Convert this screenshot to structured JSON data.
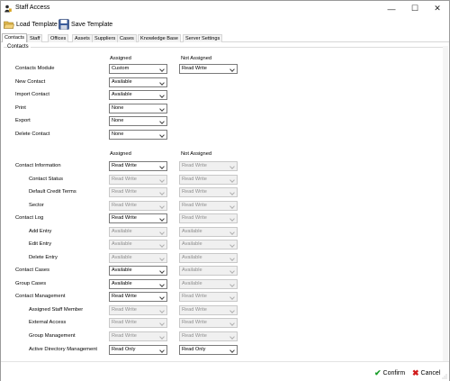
{
  "window": {
    "title": "Staff Access",
    "min_glyph": "—",
    "max_glyph": "☐",
    "close_glyph": "✕"
  },
  "toolbar": {
    "load_label": "Load Template",
    "save_label": "Save Template"
  },
  "tabs": [
    "Contacts",
    "Staff",
    "Offices",
    "Assets",
    "Suppliers",
    "Cases",
    "Knowledge Base",
    "Server Settings"
  ],
  "active_tab": "Contacts",
  "section": {
    "title": "Contacts"
  },
  "headers": {
    "assigned": "Assigned",
    "not_assigned": "Not Assigned"
  },
  "module": {
    "label": "Contacts Module",
    "assigned": "Custom",
    "not_assigned": "Read Write"
  },
  "basic_rows": [
    {
      "label": "New Contact",
      "assigned": "Available"
    },
    {
      "label": "Import Contact",
      "assigned": "Available"
    },
    {
      "label": "Print",
      "assigned": "None"
    },
    {
      "label": "Export",
      "assigned": "None"
    },
    {
      "label": "Delete Contact",
      "assigned": "None"
    }
  ],
  "detail_rows": [
    {
      "label": "Contact Information",
      "indent": false,
      "assigned": "Read Write",
      "not_assigned": "Read Write",
      "assigned_enabled": true,
      "not_enabled": false
    },
    {
      "label": "Contact Status",
      "indent": true,
      "assigned": "Read Write",
      "not_assigned": "Read Write",
      "assigned_enabled": false,
      "not_enabled": false
    },
    {
      "label": "Default Credit Terms",
      "indent": true,
      "assigned": "Read Write",
      "not_assigned": "Read Write",
      "assigned_enabled": false,
      "not_enabled": false
    },
    {
      "label": "Sector",
      "indent": true,
      "assigned": "Read Write",
      "not_assigned": "Read Write",
      "assigned_enabled": false,
      "not_enabled": false
    },
    {
      "label": "Contact Log",
      "indent": false,
      "assigned": "Read Write",
      "not_assigned": "Read Write",
      "assigned_enabled": true,
      "not_enabled": false
    },
    {
      "label": "Add Entry",
      "indent": true,
      "assigned": "Available",
      "not_assigned": "Available",
      "assigned_enabled": false,
      "not_enabled": false
    },
    {
      "label": "Edit Entry",
      "indent": true,
      "assigned": "Available",
      "not_assigned": "Available",
      "assigned_enabled": false,
      "not_enabled": false
    },
    {
      "label": "Delete Entry",
      "indent": true,
      "assigned": "Available",
      "not_assigned": "Available",
      "assigned_enabled": false,
      "not_enabled": false
    },
    {
      "label": "Contact Cases",
      "indent": false,
      "assigned": "Available",
      "not_assigned": "Available",
      "assigned_enabled": true,
      "not_enabled": false
    },
    {
      "label": "Group Cases",
      "indent": false,
      "assigned": "Available",
      "not_assigned": "Available",
      "assigned_enabled": true,
      "not_enabled": false
    },
    {
      "label": "Contact Management",
      "indent": false,
      "assigned": "Read Write",
      "not_assigned": "Read Write",
      "assigned_enabled": true,
      "not_enabled": false
    },
    {
      "label": "Assigned Staff Member",
      "indent": true,
      "assigned": "Read Write",
      "not_assigned": "Read Write",
      "assigned_enabled": false,
      "not_enabled": false
    },
    {
      "label": "External Access",
      "indent": true,
      "assigned": "Read Write",
      "not_assigned": "Read Write",
      "assigned_enabled": false,
      "not_enabled": false
    },
    {
      "label": "Group Management",
      "indent": true,
      "assigned": "Read Write",
      "not_assigned": "Read Write",
      "assigned_enabled": false,
      "not_enabled": false
    },
    {
      "label": "Active Directory Management",
      "indent": true,
      "assigned": "Read Only",
      "not_assigned": "Read Only",
      "assigned_enabled": true,
      "not_enabled": true
    }
  ],
  "footer": {
    "confirm_label": "Confirm",
    "cancel_label": "Cancel"
  },
  "colors": {
    "confirm_green": "#1a9e2a",
    "cancel_red": "#d11a1a",
    "disabled_text": "#8e8e8e"
  },
  "icons": [
    "app-icon",
    "folder-open-icon",
    "floppy-disk-icon",
    "checkmark-icon",
    "cross-icon"
  ]
}
